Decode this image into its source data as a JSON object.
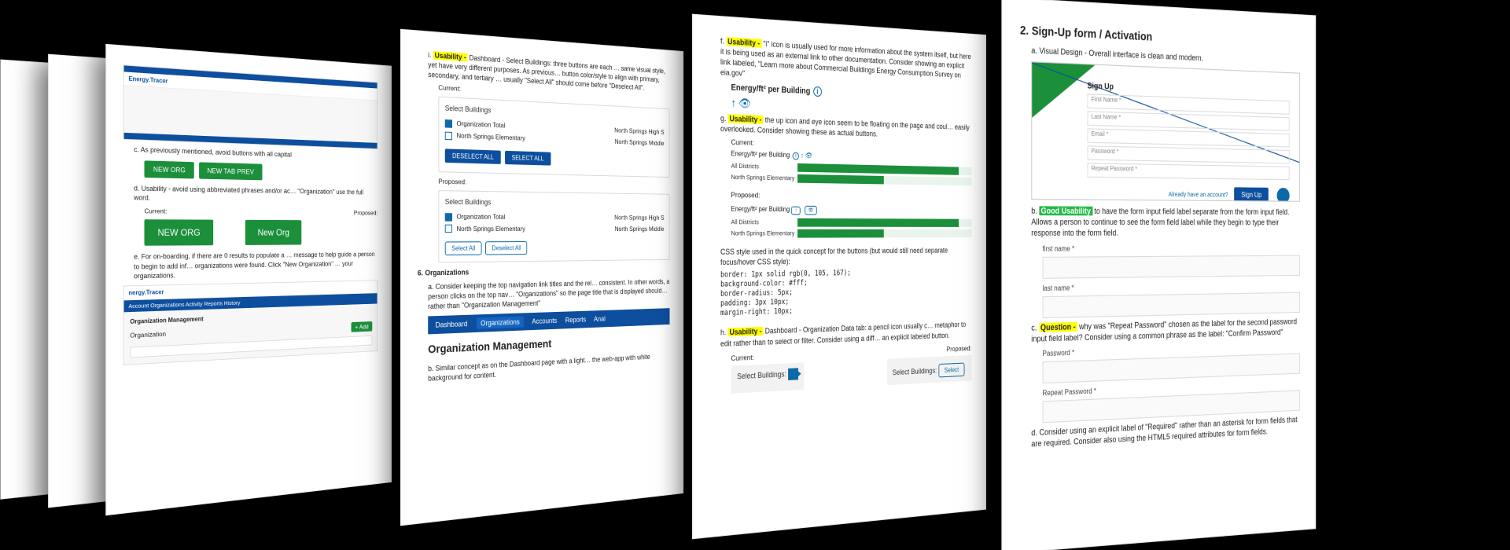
{
  "page2": {
    "brand": "Energy.Tracer",
    "c_text": "c.  As previously mentioned, avoid buttons with all capital",
    "btn_neworg": "NEW ORG",
    "btn_newtab": "NEW TAB PREV",
    "d_text": "d.  Usability - avoid using abbreviated phrases and/or ac… \"Organization\" use the full word.",
    "current": "Current:",
    "proposed": "Proposed:",
    "btn_neworg_big": "NEW ORG",
    "btn_neworg_prop": "New Org",
    "e_text": "e.  For on-boarding, if there are 0 results to populate a … message to help guide a person to begin to add inf… organizations were found. Click \"New Organization\" … your organizations.",
    "brand2": "nergy.Tracer",
    "nav": "Account  Organizations  Activity  Reports  History",
    "org_mgmt": "Organization Management",
    "org_lbl": "Organization",
    "pill": "+ Add"
  },
  "page3": {
    "i_text": "i.  ",
    "i_tag": "Usability -",
    "i_body": " Dashboard - Select Buildings: three buttons are each … same visual style, yet have very different purposes. As previous… button color/style to align with primary, secondary, and tertiary … usually \"Select All\" should come before \"Deselect All\".",
    "current": "Current:",
    "proposed": "Proposed:",
    "card_title": "Select Buildings",
    "rows": [
      {
        "name": "Organization Total",
        "right": "North Springs High S"
      },
      {
        "name": "North Springs Elementary",
        "right": "North Springs Middle"
      }
    ],
    "btn_deselect": "DESELECT ALL",
    "btn_select": "SELECT ALL",
    "rows2": [
      {
        "name": "Organization Total",
        "right": "North Springs High S"
      },
      {
        "name": "North Springs Elementary",
        "right": "North Springs Middle"
      }
    ],
    "btn_select2": "Select All",
    "btn_deselect2": "Deselect All",
    "six": "6.  Organizations",
    "a_text": "a.  Consider keeping the top navigation link titles and the rel… consistent. In other words, a person clicks on the top nav… \"Organizations\" so the page title that is displayed should… rather than \"Organization Management\"",
    "nav_items": [
      "Dashboard",
      "Organizations",
      "Accounts",
      "Reports",
      "Anal"
    ],
    "h2": "Organization Management",
    "b_text": "b.  Similar concept as on the Dashboard page with a light… the web-app with white background for content."
  },
  "page4": {
    "f_tag": "Usability -",
    "f_body": " \"i\" icon is usually used for more information about the system itself, but here it is being used as an external link to other documentation. Consider showing an explicit link labeled, \"Learn more about Commercial Buildings Energy Consumption Survey on eia.gov\"",
    "chart_title": "Energy/ft² per Building",
    "info": "i",
    "icons": "↑  👁",
    "g_tag": "Usability -",
    "g_body": " the up icon and eye icon seem to be floating on the page and coul… easily overlooked. Consider showing these as actual buttons.",
    "current": "Current:",
    "proposed": "Proposed:",
    "mini_title": "Energy/ft² per Building",
    "bars": [
      {
        "label": "All Districts",
        "w": 92
      },
      {
        "label": "North Springs Elementary",
        "w": 48
      }
    ],
    "css_intro": "CSS style used in the quick concept for the buttons (but would still need separate focus/hover CSS style):",
    "css": "border: 1px solid rgb(0, 105, 167);\nbackground-color: #fff;\nborder-radius: 5px;\npadding: 3px 10px;\nmargin-right: 10px;",
    "h_tag": "Usability -",
    "h_body": " Dashboard - Organization Data tab: a pencil icon usually c… metaphor to edit rather than to select or filter. Consider using a diff… an explicit labeled button.",
    "sel_label": "Select Buildings:",
    "sel_label2": "Select Buildings:",
    "sel_btn": "Select"
  },
  "page5": {
    "h2": "2.  Sign-Up form / Activation",
    "a_text": "a.  Visual Design - Overall interface is clean and modern.",
    "signup_title": "Sign Up",
    "fields": [
      "First Name *",
      "Last Name *",
      "Email *",
      "Password *",
      "Repeat Password *"
    ],
    "signup_btn": "Sign Up",
    "login_link": "Already have an account?",
    "b_tag": "Good Usability",
    "b_body": " to have the form input field label separate from the form input field. Allows a person to continue to see the form field label while they begin to type their response into the form field.",
    "fn": "first name *",
    "ln": "last name *",
    "c_tag": "Question -",
    "c_body": " why was \"Repeat Password\" chosen as the label for the second password input field label? Consider using a common phrase as the label: \"Confirm Password\"",
    "pw": "Password *",
    "rpw": "Repeat Password *",
    "d_text": "d.  Consider using an explicit label of \"Required\" rather than an asterisk for form fields that are required. Consider also using the HTML5 required attributes for form fields."
  }
}
